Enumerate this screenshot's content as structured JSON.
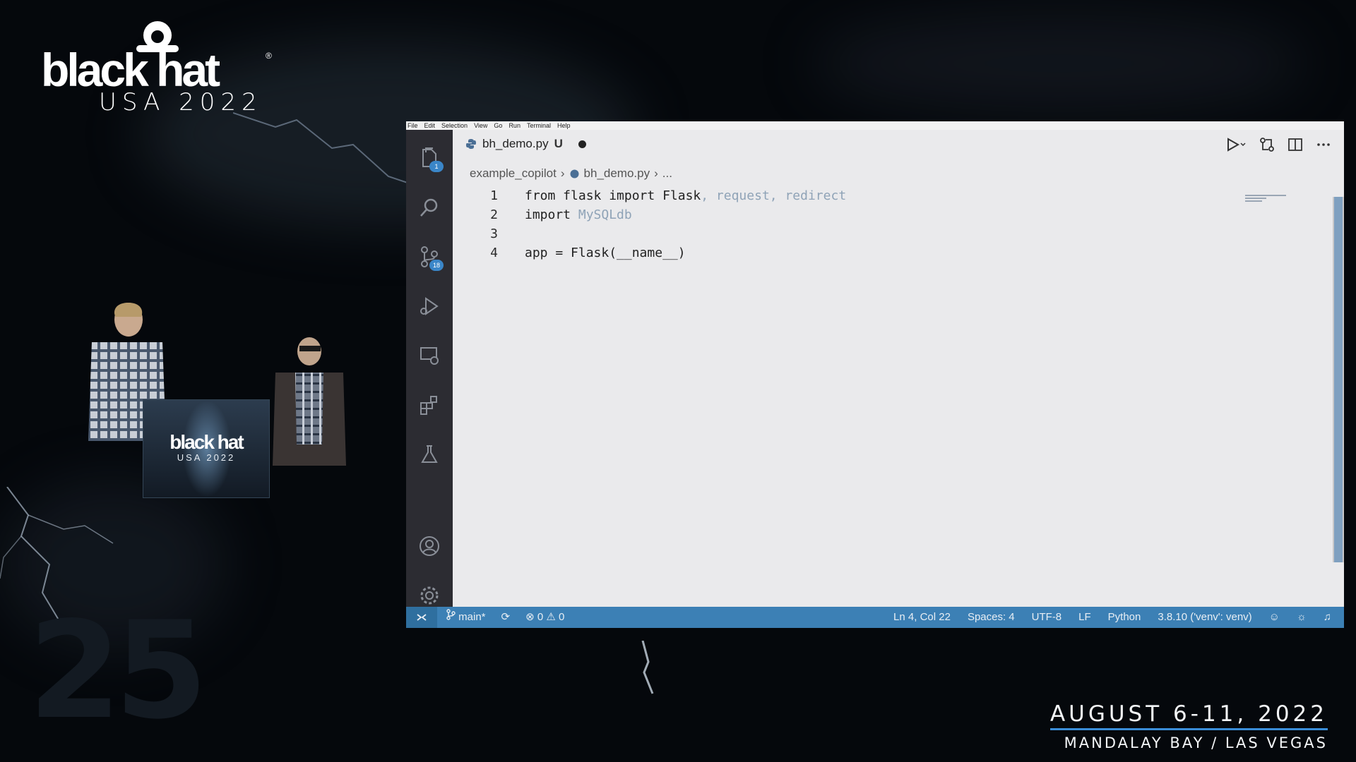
{
  "event": {
    "logo_text": "black hat",
    "logo_registered": "®",
    "logo_sub": "USA 2022",
    "podium_logo": "black hat",
    "podium_logo_sub": "USA 2022",
    "date_line": "AUGUST 6-11, 2022",
    "venue_line": "MANDALAY BAY / LAS VEGAS",
    "accent_color": "#3a8dd8"
  },
  "menubar": {
    "items": [
      "File",
      "Edit",
      "Selection",
      "View",
      "Go",
      "Run",
      "Terminal",
      "Help"
    ]
  },
  "activity_bar": {
    "explorer_badge": "1",
    "source_control_badge": "18",
    "icons": [
      "files-icon",
      "search-icon",
      "source-control-icon",
      "run-debug-icon",
      "remote-explorer-icon",
      "extensions-icon",
      "testing-icon",
      "account-icon",
      "settings-gear-icon"
    ]
  },
  "tab": {
    "filename": "bh_demo.py",
    "status": "U"
  },
  "breadcrumb": {
    "folder": "example_copilot",
    "file": "bh_demo.py",
    "more": "..."
  },
  "code": {
    "lines": [
      {
        "num": "1",
        "text": "from flask import Flask",
        "ghost": ", request, redirect"
      },
      {
        "num": "2",
        "text": "import ",
        "ghost": "MySQLdb"
      },
      {
        "num": "3",
        "text": "",
        "ghost": ""
      },
      {
        "num": "4",
        "text": "app = Flask(__name__)",
        "ghost": ""
      }
    ]
  },
  "statusbar": {
    "branch": "main*",
    "errors": "0",
    "warnings": "0",
    "cursor": "Ln 4, Col 22",
    "spaces": "Spaces: 4",
    "encoding": "UTF-8",
    "eol": "LF",
    "language": "Python",
    "interpreter": "3.8.10 ('venv': venv)",
    "color": "#3c80b5"
  }
}
